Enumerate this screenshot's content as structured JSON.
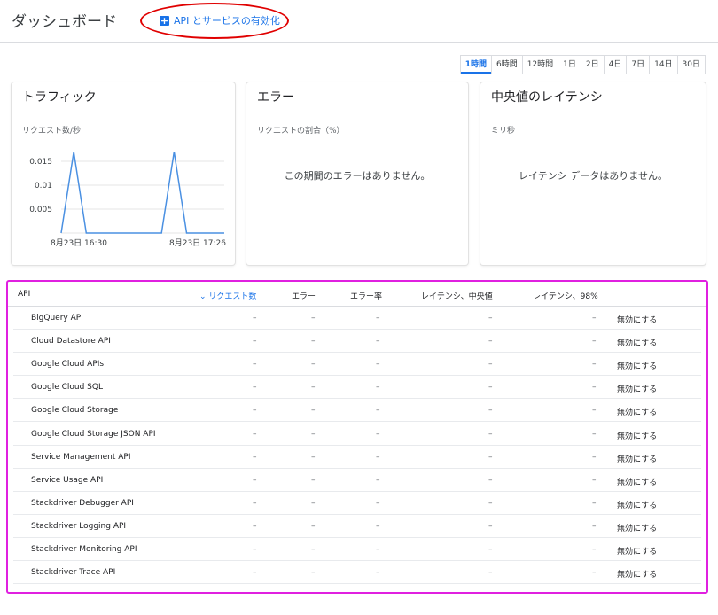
{
  "header": {
    "title": "ダッシュボード",
    "enable_label": "API とサービスの有効化"
  },
  "time_range": {
    "options": [
      "1時間",
      "6時間",
      "12時間",
      "1日",
      "2日",
      "4日",
      "7日",
      "14日",
      "30日"
    ],
    "selected": "1時間"
  },
  "cards": {
    "traffic": {
      "title": "トラフィック",
      "subtitle": "リクエスト数/秒"
    },
    "errors": {
      "title": "エラー",
      "subtitle": "リクエストの割合（%）",
      "empty": "この期間のエラーはありません。"
    },
    "latency": {
      "title": "中央値のレイテンシ",
      "subtitle": "ミリ秒",
      "empty": "レイテンシ データはありません。"
    }
  },
  "chart_data": {
    "type": "line",
    "title": "トラフィック",
    "ylabel": "リクエスト数/秒",
    "yticks": [
      "0.015",
      "0.01",
      "0.005"
    ],
    "xticks": [
      "8月23日 16:30",
      "8月23日 17:26"
    ],
    "ylim": [
      0,
      0.02
    ],
    "series": [
      {
        "values": [
          0,
          0.017,
          0,
          0,
          0,
          0,
          0,
          0,
          0,
          0.017,
          0,
          0,
          0,
          0
        ]
      }
    ],
    "line_color": "#4a90e2",
    "grid": true
  },
  "table": {
    "columns": {
      "api": "API",
      "requests": "リクエスト数",
      "errors": "エラー",
      "error_rate": "エラー率",
      "latency_median": "レイテンシ、中央値",
      "latency_98": "レイテンシ、98%"
    },
    "rows": [
      {
        "name": "BigQuery API",
        "requests": "–",
        "errors": "–",
        "error_rate": "–",
        "latency_median": "–",
        "latency_98": "–",
        "action": "無効にする"
      },
      {
        "name": "Cloud Datastore API",
        "requests": "–",
        "errors": "–",
        "error_rate": "–",
        "latency_median": "–",
        "latency_98": "–",
        "action": "無効にする"
      },
      {
        "name": "Google Cloud APIs",
        "requests": "–",
        "errors": "–",
        "error_rate": "–",
        "latency_median": "–",
        "latency_98": "–",
        "action": "無効にする"
      },
      {
        "name": "Google Cloud SQL",
        "requests": "–",
        "errors": "–",
        "error_rate": "–",
        "latency_median": "–",
        "latency_98": "–",
        "action": "無効にする"
      },
      {
        "name": "Google Cloud Storage",
        "requests": "–",
        "errors": "–",
        "error_rate": "–",
        "latency_median": "–",
        "latency_98": "–",
        "action": "無効にする"
      },
      {
        "name": "Google Cloud Storage JSON API",
        "requests": "–",
        "errors": "–",
        "error_rate": "–",
        "latency_median": "–",
        "latency_98": "–",
        "action": "無効にする"
      },
      {
        "name": "Service Management API",
        "requests": "–",
        "errors": "–",
        "error_rate": "–",
        "latency_median": "–",
        "latency_98": "–",
        "action": "無効にする"
      },
      {
        "name": "Service Usage API",
        "requests": "–",
        "errors": "–",
        "error_rate": "–",
        "latency_median": "–",
        "latency_98": "–",
        "action": "無効にする"
      },
      {
        "name": "Stackdriver Debugger API",
        "requests": "–",
        "errors": "–",
        "error_rate": "–",
        "latency_median": "–",
        "latency_98": "–",
        "action": "無効にする"
      },
      {
        "name": "Stackdriver Logging API",
        "requests": "–",
        "errors": "–",
        "error_rate": "–",
        "latency_median": "–",
        "latency_98": "–",
        "action": "無効にする"
      },
      {
        "name": "Stackdriver Monitoring API",
        "requests": "–",
        "errors": "–",
        "error_rate": "–",
        "latency_median": "–",
        "latency_98": "–",
        "action": "無効にする"
      },
      {
        "name": "Stackdriver Trace API",
        "requests": "–",
        "errors": "–",
        "error_rate": "–",
        "latency_median": "–",
        "latency_98": "–",
        "action": "無効にする"
      }
    ]
  }
}
